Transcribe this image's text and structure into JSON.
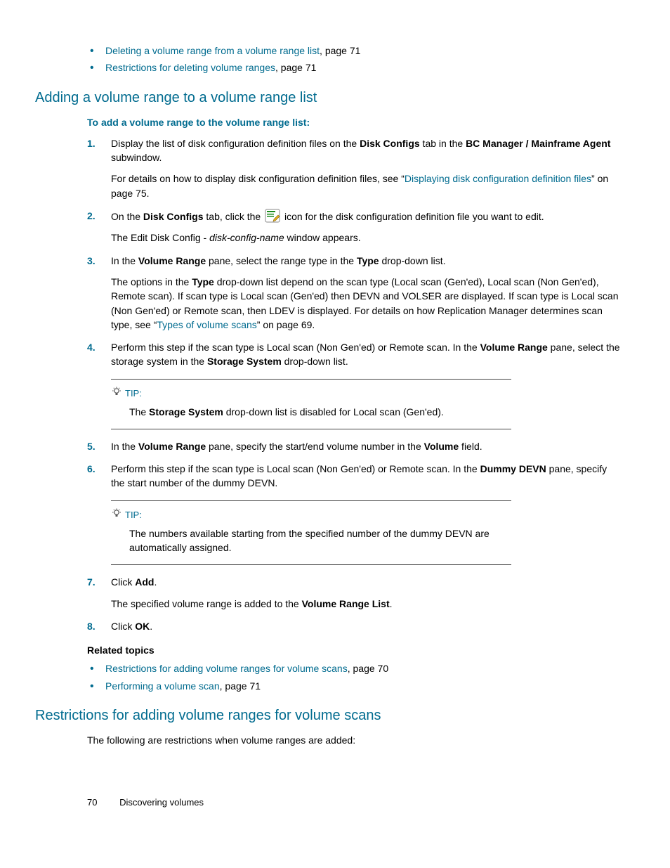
{
  "top_bullets": [
    {
      "link": "Deleting a volume range from a volume range list",
      "tail": ", page 71"
    },
    {
      "link": "Restrictions for deleting volume ranges",
      "tail": ", page 71"
    }
  ],
  "h_add": "Adding a volume range to a volume range list",
  "intro": "To add a volume range to the volume range list:",
  "step1": {
    "num": "1.",
    "a": "Display the list of disk configuration definition files on the ",
    "b1": "Disk Configs",
    "c": " tab in the ",
    "b2": "BC Manager / Mainframe Agent",
    "d": " subwindow.",
    "p2a": "For details on how to display disk configuration definition files, see “",
    "p2link": "Displaying disk configuration definition files",
    "p2b": "” on page 75."
  },
  "step2": {
    "num": "2.",
    "a": "On the ",
    "b1": "Disk Configs",
    "b": " tab, click the ",
    "c": " icon for the disk configuration definition file you want to edit.",
    "p2a": "The Edit Disk Config - ",
    "p2i": "disk-config-name",
    "p2b": " window appears."
  },
  "step3": {
    "num": "3.",
    "a": "In the ",
    "b1": "Volume Range",
    "b": " pane, select the range type in the ",
    "b2": "Type",
    "c": " drop-down list.",
    "p2a": "The options in the ",
    "p2b1": "Type",
    "p2b": " drop-down list depend on the scan type (Local scan (Gen'ed), Local scan (Non Gen'ed), Remote scan). If scan type is Local scan (Gen'ed) then DEVN and VOLSER are displayed. If scan type is Local scan (Non Gen'ed) or Remote scan, then LDEV is displayed. For details on how Replication Manager determines scan type, see “",
    "p2link": "Types of volume scans",
    "p2c": "” on page 69."
  },
  "step4": {
    "num": "4.",
    "a": "Perform this step if the scan type is Local scan (Non Gen'ed) or Remote scan. In the ",
    "b1": "Volume Range",
    "b": " pane, select the storage system in the ",
    "b2": "Storage System",
    "c": " drop-down list."
  },
  "tip1": {
    "label": "TIP:",
    "a": "The ",
    "b1": "Storage System",
    "b": " drop-down list is disabled for Local scan (Gen'ed)."
  },
  "step5": {
    "num": "5.",
    "a": "In the ",
    "b1": "Volume Range",
    "b": " pane, specify the start/end volume number in the ",
    "b2": "Volume",
    "c": " field."
  },
  "step6": {
    "num": "6.",
    "a": "Perform this step if the scan type is Local scan (Non Gen'ed) or Remote scan. In the ",
    "b1": "Dummy DEVN",
    "b": " pane, specify the start number of the dummy DEVN."
  },
  "tip2": {
    "label": "TIP:",
    "body": "The numbers available starting from the specified number of the dummy DEVN are automatically assigned."
  },
  "step7": {
    "num": "7.",
    "a": "Click ",
    "b1": "Add",
    "b": ".",
    "p2a": "The specified volume range is added to the ",
    "p2b1": "Volume Range List",
    "p2b": "."
  },
  "step8": {
    "num": "8.",
    "a": "Click ",
    "b1": "OK",
    "b": "."
  },
  "related": {
    "head": "Related topics",
    "items": [
      {
        "link": "Restrictions for adding volume ranges for volume scans",
        "tail": ", page 70"
      },
      {
        "link": "Performing a volume scan",
        "tail": ", page 71"
      }
    ]
  },
  "h_restrict": "Restrictions for adding volume ranges for volume scans",
  "restrict_intro": "The following are restrictions when volume ranges are added:",
  "footer": {
    "page": "70",
    "chapter": "Discovering volumes"
  }
}
